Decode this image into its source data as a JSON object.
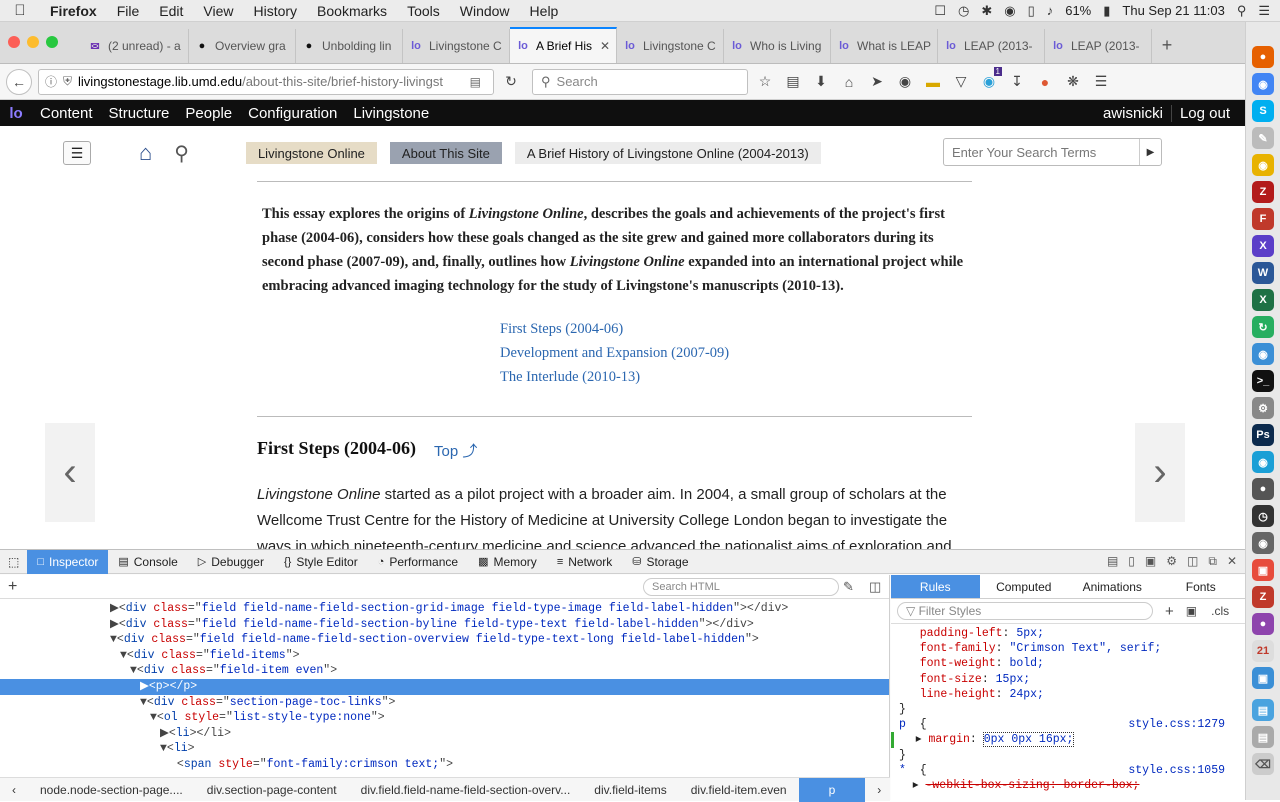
{
  "menubar": {
    "app": "Firefox",
    "items": [
      "File",
      "Edit",
      "View",
      "History",
      "Bookmarks",
      "Tools",
      "Window",
      "Help"
    ],
    "battery": "61%",
    "clock": "Thu Sep 21  11:03"
  },
  "tabs": [
    {
      "label": "(2 unread) - a",
      "icon": "mail-icon"
    },
    {
      "label": "Overview gra",
      "icon": "github-icon"
    },
    {
      "label": "Unbolding lin",
      "icon": "github-icon"
    },
    {
      "label": "Livingstone C",
      "icon": "lo-icon"
    },
    {
      "label": "A Brief His",
      "icon": "lo-icon",
      "active": true
    },
    {
      "label": "Livingstone C",
      "icon": "lo-icon"
    },
    {
      "label": "Who is Living",
      "icon": "lo-icon"
    },
    {
      "label": "What is LEAP",
      "icon": "lo-icon"
    },
    {
      "label": "LEAP (2013-",
      "icon": "lo-icon"
    },
    {
      "label": "LEAP (2013-",
      "icon": "lo-icon"
    }
  ],
  "url": {
    "host": "livingstonestage.lib.umd.edu",
    "path": "/about-this-site/brief-history-livingst"
  },
  "browser_search": {
    "placeholder": "Search"
  },
  "notification_badge": "1",
  "admin": {
    "items": [
      "Content",
      "Structure",
      "People",
      "Configuration",
      "Livingstone"
    ],
    "user": "awisnicki",
    "logout": "Log out"
  },
  "breadcrumbs": [
    "Livingstone Online",
    "About This Site",
    "A Brief History of Livingstone Online (2004-2013)"
  ],
  "site_search": {
    "placeholder": "Enter Your Search Terms"
  },
  "intro": {
    "p1": "This essay explores the origins of ",
    "em1": "Livingstone Online",
    "p2": ", describes the goals and achievements of the project's first phase (2004-06), considers how these goals changed as the site grew and gained more collaborators during its second phase (2007-09), and, finally, outlines how ",
    "em2": "Livingstone Online",
    "p3": " expanded into an international project while embracing advanced imaging technology for the study of Livingstone's manuscripts (2010-13)."
  },
  "toc": [
    "First Steps (2004-06)",
    "Development and Expansion (2007-09)",
    "The Interlude (2010-13)"
  ],
  "section": {
    "title": "First Steps (2004-06)",
    "top": "Top",
    "em": "Livingstone Online",
    "text": " started as a pilot project with a broader aim. In 2004, a small group of scholars at the Wellcome Trust Centre for the History of Medicine at University College London began to investigate the ways in which nineteenth-century medicine and science advanced the nationalist aims of exploration and"
  },
  "devtools": {
    "tabs": [
      "Inspector",
      "Console",
      "Debugger",
      "Style Editor",
      "Performance",
      "Memory",
      "Network",
      "Storage"
    ],
    "search_html": "Search HTML",
    "markup": [
      {
        "indent": 8,
        "arrow": "▶",
        "tag": "div",
        "cls": "field field-name-field-section-grid-image field-type-image field-label-hidden",
        "tail": "></div>"
      },
      {
        "indent": 8,
        "arrow": "▶",
        "tag": "div",
        "cls": "field field-name-field-section-byline field-type-text field-label-hidden",
        "tail": "></div>"
      },
      {
        "indent": 8,
        "arrow": "▼",
        "tag": "div",
        "cls": "field field-name-field-section-overview field-type-text-long field-label-hidden",
        "tail": ">"
      },
      {
        "indent": 9,
        "arrow": "▼",
        "tag": "div",
        "cls": "field-items",
        "tail": ">"
      },
      {
        "indent": 10,
        "arrow": "▼",
        "tag": "div",
        "cls": "field-item even",
        "tail": ">"
      },
      {
        "indent": 11,
        "arrow": "▶",
        "tag": "p",
        "cls": "",
        "tail": "></p>",
        "selected": true
      },
      {
        "indent": 11,
        "arrow": "▼",
        "tag": "div",
        "cls": "section-page-toc-links",
        "tail": ">"
      },
      {
        "indent": 12,
        "arrow": "▼",
        "tag": "ol",
        "attrname": "style",
        "cls": "list-style-type:none",
        "tail": ">"
      },
      {
        "indent": 13,
        "arrow": "▶",
        "tag": "li",
        "cls": "",
        "tail": "></li>"
      },
      {
        "indent": 13,
        "arrow": "▼",
        "tag": "li",
        "cls": "",
        "tail": ">"
      },
      {
        "indent": 14,
        "arrow": "",
        "tag": "span",
        "attrname": "style",
        "cls": "font-family:crimson text;",
        "tail": ">"
      }
    ],
    "breadcrumbs": [
      "node.node-section-page....",
      "div.section-page-content",
      "div.field.field-name-field-section-overv...",
      "div.field-items",
      "div.field-item.even",
      "p"
    ],
    "rule_tabs": [
      "Rules",
      "Computed",
      "Animations",
      "Fonts"
    ],
    "filter": "Filter Styles",
    "cls": ".cls",
    "rules": [
      {
        "prop": "padding-left",
        "val": "5px;"
      },
      {
        "prop": "font-family",
        "val": "\"Crimson Text\", serif;"
      },
      {
        "prop": "font-weight",
        "val": "bold;"
      },
      {
        "prop": "font-size",
        "val": "15px;"
      },
      {
        "prop": "line-height",
        "val": "24px;"
      }
    ],
    "rule2": {
      "selector": "p",
      "src": "style.css:1279",
      "prop": "margin",
      "val": "0px 0px 16px;"
    },
    "rule3": {
      "selector": "*",
      "src": "style.css:1059",
      "prop": "-webkit-box-sizing",
      "val": "border-box;"
    }
  },
  "colors": {
    "accent": "#4a90e2",
    "link": "#2b67b0",
    "crumb1": "#e6dcc6",
    "crumb2": "#9aa2b0",
    "crumb3": "#ececec"
  }
}
